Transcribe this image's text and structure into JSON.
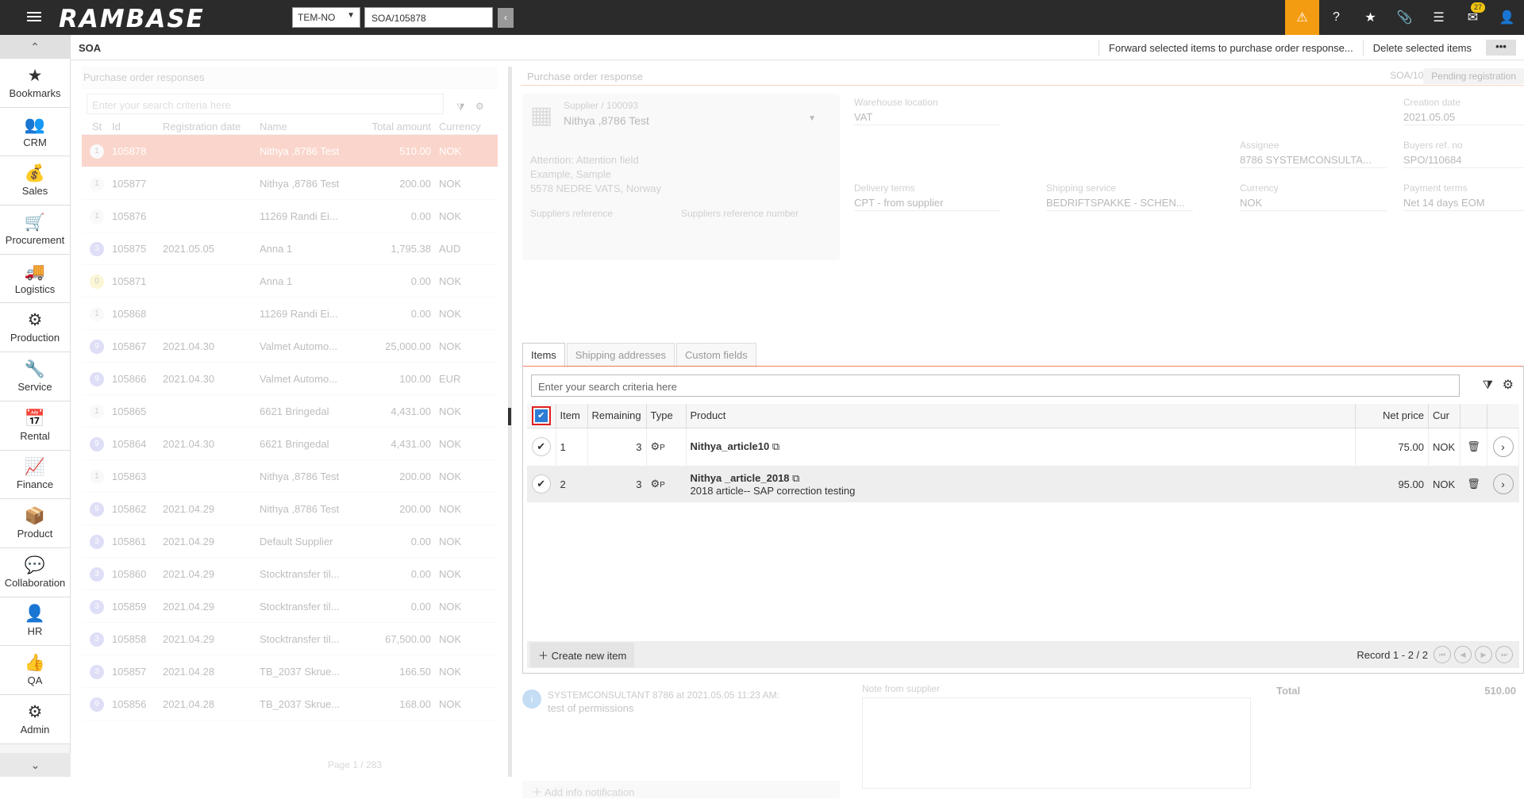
{
  "topbar": {
    "logo": "RAMBASE",
    "company": "TEM-NO",
    "document": "SOA/105878",
    "mail_count": "27"
  },
  "sidebar": {
    "items": [
      {
        "label": "Bookmarks",
        "icon": "★"
      },
      {
        "label": "CRM",
        "icon": "👥"
      },
      {
        "label": "Sales",
        "icon": "💰"
      },
      {
        "label": "Procurement",
        "icon": "🛒"
      },
      {
        "label": "Logistics",
        "icon": "🚚"
      },
      {
        "label": "Production",
        "icon": "⚙"
      },
      {
        "label": "Service",
        "icon": "🔧"
      },
      {
        "label": "Rental",
        "icon": "📅"
      },
      {
        "label": "Finance",
        "icon": "📈"
      },
      {
        "label": "Product",
        "icon": "📦"
      },
      {
        "label": "Collaboration",
        "icon": "💬"
      },
      {
        "label": "HR",
        "icon": "👤"
      },
      {
        "label": "QA",
        "icon": "👍"
      },
      {
        "label": "Admin",
        "icon": "⚙"
      }
    ]
  },
  "header": {
    "title": "SOA",
    "forward": "Forward selected items to purchase order response...",
    "delete": "Delete selected items",
    "more": "•••"
  },
  "left": {
    "title": "Purchase order responses",
    "search_placeholder": "Enter your search criteria here",
    "columns": [
      "St",
      "Id",
      "Registration date",
      "Name",
      "Total amount",
      "Currency"
    ],
    "rows": [
      {
        "st": "1",
        "id": "105878",
        "date": "",
        "name": "Nithya ,8786 Test",
        "amount": "510.00",
        "cur": "NOK"
      },
      {
        "st": "1",
        "id": "105877",
        "date": "",
        "name": "Nithya ,8786 Test",
        "amount": "200.00",
        "cur": "NOK"
      },
      {
        "st": "1",
        "id": "105876",
        "date": "",
        "name": "11269 Randi Ei...",
        "amount": "0.00",
        "cur": "NOK"
      },
      {
        "st": "3",
        "id": "105875",
        "date": "2021.05.05",
        "name": "Anna 1",
        "amount": "1,795.38",
        "cur": "AUD"
      },
      {
        "st": "0",
        "id": "105871",
        "date": "",
        "name": "Anna 1",
        "amount": "0.00",
        "cur": "NOK"
      },
      {
        "st": "1",
        "id": "105868",
        "date": "",
        "name": "11269 Randi Ei...",
        "amount": "0.00",
        "cur": "NOK"
      },
      {
        "st": "9",
        "id": "105867",
        "date": "2021.04.30",
        "name": "Valmet Automo...",
        "amount": "25,000.00",
        "cur": "NOK"
      },
      {
        "st": "9",
        "id": "105866",
        "date": "2021.04.30",
        "name": "Valmet Automo...",
        "amount": "100.00",
        "cur": "EUR"
      },
      {
        "st": "1",
        "id": "105865",
        "date": "",
        "name": "6621 Bringedal",
        "amount": "4,431.00",
        "cur": "NOK"
      },
      {
        "st": "9",
        "id": "105864",
        "date": "2021.04.30",
        "name": "6621 Bringedal",
        "amount": "4,431.00",
        "cur": "NOK"
      },
      {
        "st": "1",
        "id": "105863",
        "date": "",
        "name": "Nithya ,8786 Test",
        "amount": "200.00",
        "cur": "NOK"
      },
      {
        "st": "9",
        "id": "105862",
        "date": "2021.04.29",
        "name": "Nithya ,8786 Test",
        "amount": "200.00",
        "cur": "NOK"
      },
      {
        "st": "3",
        "id": "105861",
        "date": "2021.04.29",
        "name": "Default Supplier",
        "amount": "0.00",
        "cur": "NOK"
      },
      {
        "st": "3",
        "id": "105860",
        "date": "2021.04.29",
        "name": "Stocktransfer til...",
        "amount": "0.00",
        "cur": "NOK"
      },
      {
        "st": "3",
        "id": "105859",
        "date": "2021.04.29",
        "name": "Stocktransfer til...",
        "amount": "0.00",
        "cur": "NOK"
      },
      {
        "st": "3",
        "id": "105858",
        "date": "2021.04.29",
        "name": "Stocktransfer til...",
        "amount": "67,500.00",
        "cur": "NOK"
      },
      {
        "st": "3",
        "id": "105857",
        "date": "2021.04.28",
        "name": "TB_2037 Skrue...",
        "amount": "166.50",
        "cur": "NOK"
      },
      {
        "st": "9",
        "id": "105856",
        "date": "2021.04.28",
        "name": "TB_2037 Skrue...",
        "amount": "168.00",
        "cur": "NOK"
      }
    ],
    "pager": "Page 1 / 283"
  },
  "right": {
    "title": "Purchase order response",
    "doc_id": "SOA/105878",
    "status": "Pending registration",
    "supplier_label": "Supplier / 100093",
    "supplier_name": "Nithya ,8786 Test",
    "attention": "Attention: Attention field",
    "address1": "Example, Sample",
    "address2": "5578 NEDRE VATS, Norway",
    "suppliers_reference": "Suppliers reference",
    "suppliers_reference_number": "Suppliers reference number",
    "warehouse_label": "Warehouse location",
    "warehouse_value": "VAT",
    "creation_label": "Creation date",
    "creation_value": "2021.05.05",
    "assignee_label": "Assignee",
    "assignee_value": "8786 SYSTEMCONSULTA...",
    "buyers_label": "Buyers ref. no",
    "buyers_value": "SPO/110684",
    "delivery_label": "Delivery terms",
    "delivery_value": "CPT - from supplier",
    "shipping_label": "Shipping service",
    "shipping_value": "BEDRIFTSPAKKE - SCHEN...",
    "currency_label": "Currency",
    "currency_value": "NOK",
    "payment_label": "Payment terms",
    "payment_value": "Net 14 days EOM",
    "tabs": [
      "Items",
      "Shipping addresses",
      "Custom fields"
    ],
    "items": {
      "search_placeholder": "Enter your search criteria here",
      "columns": [
        "Item",
        "Remaining",
        "Type",
        "Product",
        "Net price",
        "Cur"
      ],
      "rows": [
        {
          "item": "1",
          "remaining": "3",
          "type": "P",
          "product": "Nithya_article10",
          "desc": "",
          "price": "75.00",
          "cur": "NOK"
        },
        {
          "item": "2",
          "remaining": "3",
          "type": "P",
          "product": "Nithya _article_2018",
          "desc": "2018 article-- SAP correction testing",
          "price": "95.00",
          "cur": "NOK"
        }
      ],
      "new_item": "Create new item",
      "record": "Record 1 - 2 / 2"
    },
    "note_author": "SYSTEMCONSULTANT 8786 at 2021.05.05 11:23 AM:",
    "note_text": "test of permissions",
    "note_supplier_label": "Note from supplier",
    "add_info": "Add info notification",
    "total_label": "Total",
    "total_value": "510.00"
  }
}
